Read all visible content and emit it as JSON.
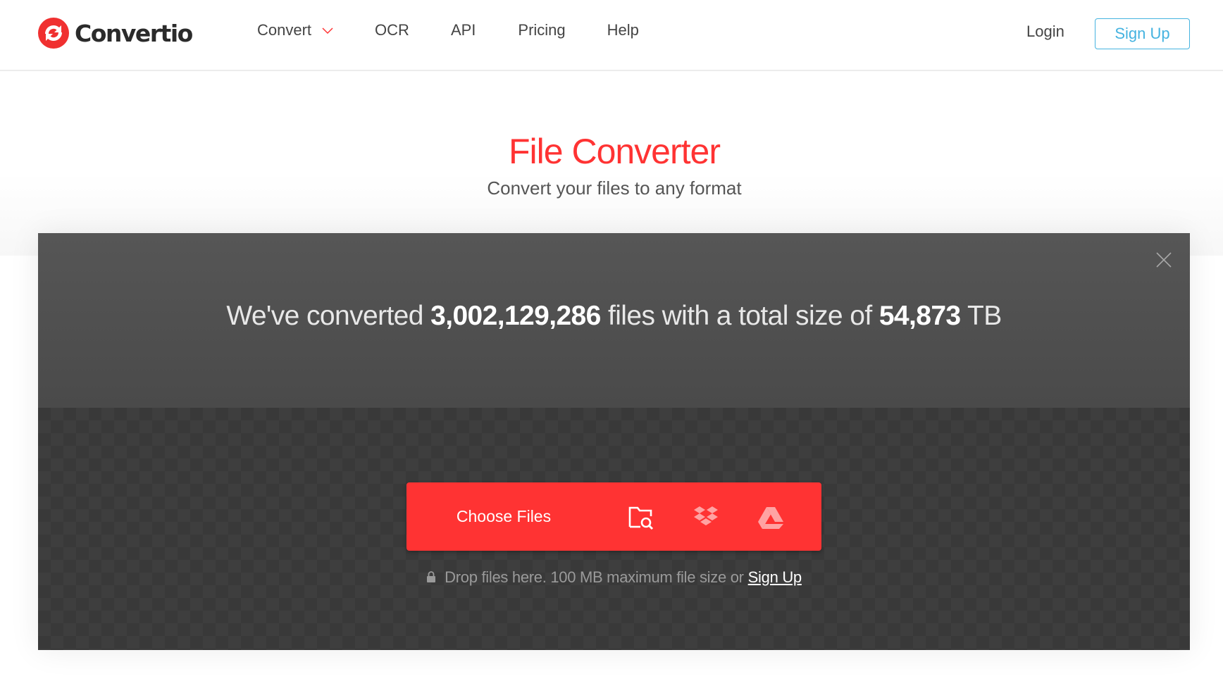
{
  "header": {
    "logo_text": "Convertio",
    "nav": [
      {
        "label": "Convert",
        "has_dropdown": true
      },
      {
        "label": "OCR"
      },
      {
        "label": "API"
      },
      {
        "label": "Pricing"
      },
      {
        "label": "Help"
      }
    ],
    "login_label": "Login",
    "signup_label": "Sign Up"
  },
  "hero": {
    "title": "File Converter",
    "subtitle": "Convert your files to any format"
  },
  "stats": {
    "prefix": "We've converted",
    "files_count": "3,002,129,286",
    "middle": "files with a total size of",
    "total_size": "54,873",
    "unit": "TB"
  },
  "upload": {
    "choose_label": "Choose Files",
    "sources": [
      {
        "name": "computer",
        "icon": "folder-search-icon"
      },
      {
        "name": "dropbox",
        "icon": "dropbox-icon"
      },
      {
        "name": "google-drive",
        "icon": "google-drive-icon"
      }
    ],
    "hint_text": "Drop files here. 100 MB maximum file size or",
    "hint_link": "Sign Up"
  },
  "colors": {
    "brand_red": "#ff3333",
    "signup_blue": "#45b3e0",
    "panel_dark": "#4f4f4f"
  }
}
